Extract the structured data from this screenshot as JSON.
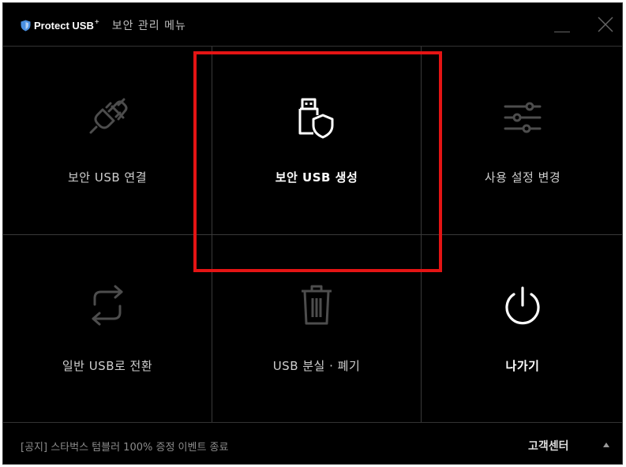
{
  "titlebar": {
    "brand_name": "Protect USB",
    "brand_plus": "+",
    "title": "보안 관리 메뉴"
  },
  "menu": {
    "connect_label": "보안 USB 연결",
    "create_label": "보안 USB 생성",
    "settings_label": "사용 설정 변경",
    "convert_label": "일반 USB로 전환",
    "lost_label": "USB 분실 · 폐기",
    "exit_label": "나가기"
  },
  "footer": {
    "notice": "[공지] 스타벅스 텀블러 100% 증정 이벤트 종료",
    "support_label": "고객센터"
  },
  "colors": {
    "background": "#000000",
    "highlight": "#e41414",
    "brand_shield": "#4a90e2"
  },
  "icons": {
    "connect": "plug-icon",
    "create": "usb-shield-icon",
    "settings": "sliders-icon",
    "convert": "refresh-icon",
    "lost": "trash-icon",
    "exit": "power-icon"
  }
}
